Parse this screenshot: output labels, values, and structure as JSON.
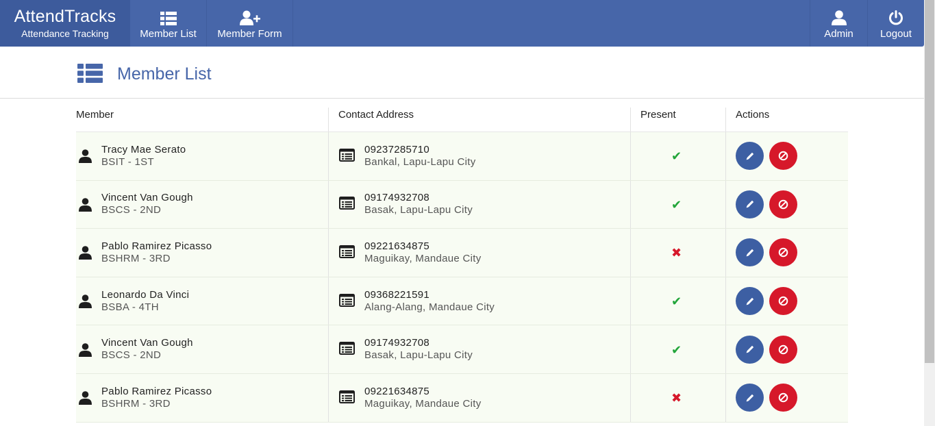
{
  "brand": {
    "title": "AttendTracks",
    "subtitle": "Attendance Tracking"
  },
  "nav": {
    "left": [
      {
        "label": "Member List",
        "icon": "list-icon"
      },
      {
        "label": "Member Form",
        "icon": "user-plus-icon"
      }
    ],
    "right": [
      {
        "label": "Admin",
        "icon": "user-icon"
      },
      {
        "label": "Logout",
        "icon": "power-icon"
      }
    ]
  },
  "page": {
    "title": "Member List",
    "icon": "list-icon"
  },
  "table": {
    "headers": {
      "member": "Member",
      "contact": "Contact Address",
      "present": "Present",
      "actions": "Actions"
    },
    "rows": [
      {
        "name": "Tracy Mae Serato",
        "course": "BSIT - 1ST",
        "phone": "09237285710",
        "address": "Bankal, Lapu-Lapu City",
        "present": true
      },
      {
        "name": "Vincent Van Gough",
        "course": "BSCS - 2ND",
        "phone": "09174932708",
        "address": "Basak, Lapu-Lapu City",
        "present": true
      },
      {
        "name": "Pablo Ramirez Picasso",
        "course": "BSHRM - 3RD",
        "phone": "09221634875",
        "address": "Maguikay, Mandaue City",
        "present": false
      },
      {
        "name": "Leonardo Da Vinci",
        "course": "BSBA - 4TH",
        "phone": "09368221591",
        "address": "Alang-Alang, Mandaue City",
        "present": true
      },
      {
        "name": "Vincent Van Gough",
        "course": "BSCS - 2ND",
        "phone": "09174932708",
        "address": "Basak, Lapu-Lapu City",
        "present": true
      },
      {
        "name": "Pablo Ramirez Picasso",
        "course": "BSHRM - 3RD",
        "phone": "09221634875",
        "address": "Maguikay, Mandaue City",
        "present": false
      }
    ]
  },
  "colors": {
    "navbar": "#4766a9",
    "brand_bg": "#3d5b9c",
    "present_yes": "#22a53a",
    "present_no": "#d6182a",
    "edit_button": "#3d5fa3",
    "delete_button": "#d6182a",
    "row_bg": "#f8fcf3"
  }
}
